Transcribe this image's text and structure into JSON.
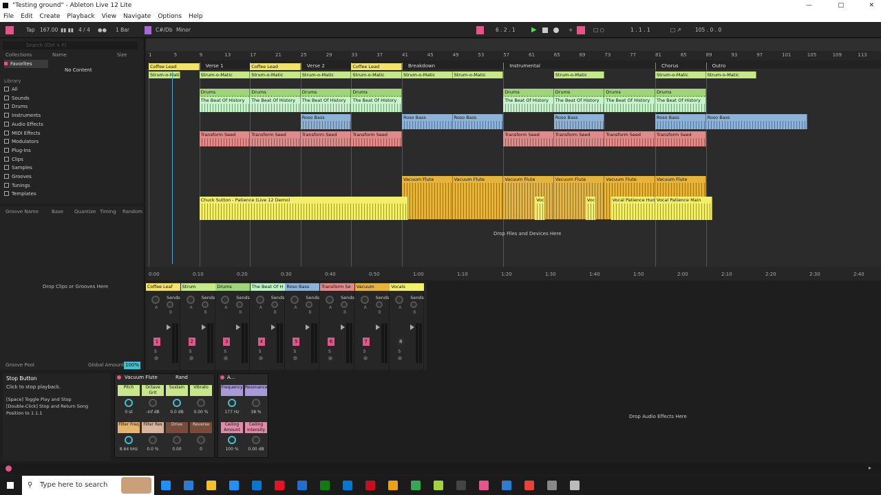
{
  "window": {
    "title": "\"Testing ground\" - Ableton Live 12 Lite"
  },
  "menu": [
    "File",
    "Edit",
    "Create",
    "Playback",
    "View",
    "Navigate",
    "Options",
    "Help"
  ],
  "control_bar": {
    "tap": "Tap",
    "tempo": "167.00",
    "signature": "4 / 4",
    "quantize": "1 Bar",
    "key": "C#/Db",
    "scale": "Minor",
    "position": "6 .  2 .  1",
    "loop_start": "1 .  1 .  1",
    "loop_length": "105 .  0 .  0"
  },
  "browser": {
    "search_placeholder": "Search (Ctrl + F)",
    "collections_label": "Collections",
    "favorites": "Favorites",
    "library_label": "Library",
    "col_name": "Name",
    "col_size": "Size",
    "no_content": "No Content",
    "items": [
      "All",
      "Sounds",
      "Drums",
      "Instruments",
      "Audio Effects",
      "MIDI Effects",
      "Modulators",
      "Plug-Ins",
      "Clips",
      "Samples",
      "Grooves",
      "Tunings",
      "Templates"
    ]
  },
  "groove": {
    "headers": [
      "Groove Name",
      "Base",
      "Quantize",
      "Timing",
      "Random"
    ],
    "drop_text": "Drop Clips or Grooves Here",
    "pool_label": "Groove Pool",
    "global_amount_label": "Global Amount",
    "global_amount": "100%"
  },
  "arrangement": {
    "bar_numbers": [
      "1",
      "5",
      "9",
      "13",
      "17",
      "21",
      "25",
      "29",
      "33",
      "37",
      "41",
      "45",
      "49",
      "53",
      "57",
      "61",
      "65",
      "69",
      "73",
      "77",
      "81",
      "85",
      "89",
      "93",
      "97",
      "101",
      "105",
      "109",
      "113"
    ],
    "time_labels": [
      "0:00",
      "0:10",
      "0:20",
      "0:30",
      "0:40",
      "0:50",
      "1:00",
      "1:10",
      "1:20",
      "1:30",
      "1:40",
      "1:50",
      "2:00",
      "2:10",
      "2:20",
      "2:30",
      "2:40"
    ],
    "locators": [
      "Intro",
      "Verse 1",
      "Chorus",
      "Verse 2",
      "Chorus",
      "Breakdown",
      "Instrumental",
      "Chorus",
      "Outro"
    ],
    "drop_text": "Drop Files and Devices Here",
    "clip_names": {
      "coffee": "Coffee Lead",
      "strum": "Strum-o-Matic",
      "strum_short": "Strum-o-Matic",
      "drums": "Drums",
      "beat": "The Beat Of History",
      "bass": "Roso Bass",
      "transform": "Transform Seed",
      "flute": "Vacuum Flute",
      "vocal_long": "Chuck Sutton - Patience (Live 12 Demo)",
      "voc_short": "Voc",
      "vocal_hum": "Vocal Patience Hum",
      "vocal_main": "Vocal Patience Main"
    }
  },
  "mixer": {
    "sends_label": "Sends",
    "a": "A",
    "b": "B",
    "s": "S",
    "channels": [
      {
        "name": "Coffee Leaf",
        "num": "1",
        "color": "#f2e26a"
      },
      {
        "name": "Strum",
        "num": "2",
        "color": "#c5e88a"
      },
      {
        "name": "Drums",
        "num": "3",
        "color": "#9fd47a"
      },
      {
        "name": "The Beat Of H",
        "num": "4",
        "color": "#bff3c4"
      },
      {
        "name": "Roso Bass",
        "num": "5",
        "color": "#8eb3d8"
      },
      {
        "name": "Transform Se",
        "num": "6",
        "color": "#e08a8a"
      },
      {
        "name": "Vacuum",
        "num": "7",
        "color": "#e6b43a"
      },
      {
        "name": "Vocals",
        "num": "8",
        "color": "#f4ef6a"
      }
    ]
  },
  "info_view": {
    "title": "Stop Button",
    "desc": "Click to stop playback.",
    "l1": "[Space] Toggle Play and Stop",
    "l2": "[Double-Click] Stop and Return Song",
    "l3": "Position to 1.1.1"
  },
  "device": {
    "name": "Vacuum Flute",
    "rand": "Rand",
    "macros": [
      {
        "label": "Pitch",
        "value": "0 st",
        "color": "#c8e68a"
      },
      {
        "label": "Octave Grit",
        "value": "-inf dB",
        "color": "#c8e68a"
      },
      {
        "label": "Sustain",
        "value": "0.0 dB",
        "color": "#c8e68a"
      },
      {
        "label": "Vibrato",
        "value": "0.00 %",
        "color": "#c8e68a"
      },
      {
        "label": "Filter Freq",
        "value": "8.64 kHz",
        "color": "#e6b46a"
      },
      {
        "label": "Filter Res",
        "value": "0.0 %",
        "color": "#d8b49a"
      },
      {
        "label": "Drive",
        "value": "0.00",
        "color": "#7a4a3a"
      },
      {
        "label": "Reverse",
        "value": "0",
        "color": "#7a4a3a"
      }
    ],
    "name2": "A...",
    "macros2": [
      {
        "label": "Frequency",
        "value": "177 Hz",
        "color": "#a89ad8"
      },
      {
        "label": "Resonance",
        "value": "38 %",
        "color": "#a89ad8"
      },
      {
        "label": "Ceiling Amount",
        "value": "100 %",
        "color": "#e08aa8"
      },
      {
        "label": "Ceiling Intensity",
        "value": "0.00 dB",
        "color": "#e08aa8"
      }
    ],
    "drop_text": "Drop Audio Effects Here"
  },
  "taskbar": {
    "search": "Type here to search"
  }
}
